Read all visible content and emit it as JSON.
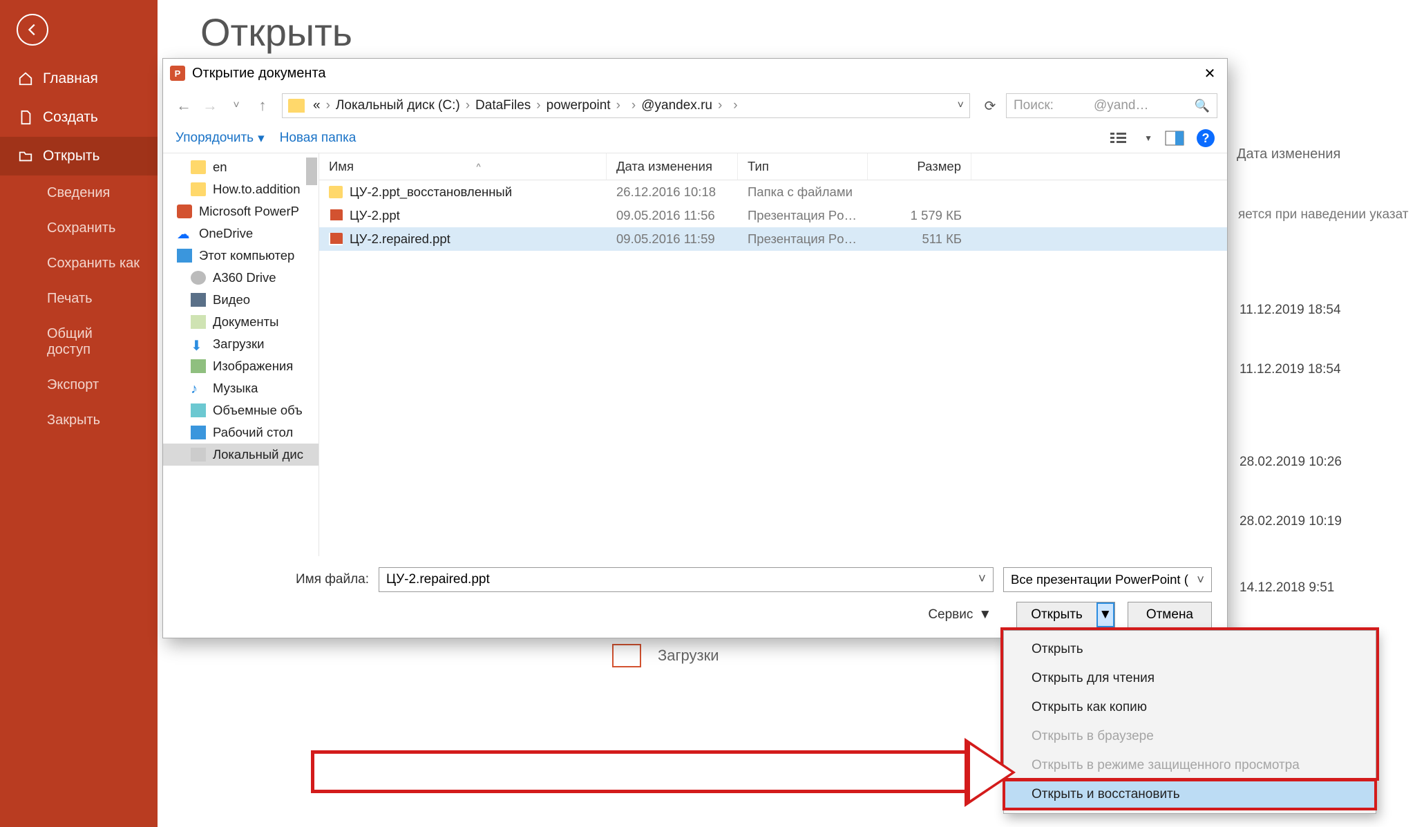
{
  "sidebar": {
    "items": [
      {
        "label": "Главная"
      },
      {
        "label": "Создать"
      },
      {
        "label": "Открыть"
      }
    ],
    "subs": [
      "Сведения",
      "Сохранить",
      "Сохранить как",
      "Печать",
      "Общий доступ",
      "Экспорт",
      "Закрыть"
    ]
  },
  "page_title": "Открыть",
  "dialog": {
    "title": "Открытие документа",
    "breadcrumbs": [
      "«",
      "Локальный диск (C:)",
      "DataFiles",
      "powerpoint",
      "",
      "@yandex.ru",
      ""
    ],
    "search_placeholder": "Поиск:",
    "search_right": "@yand…",
    "toolbar": {
      "organize": "Упорядочить",
      "newfolder": "Новая папка"
    },
    "tree": [
      {
        "label": "en",
        "icon": "folder",
        "sub": true
      },
      {
        "label": "How.to.addition",
        "icon": "folder",
        "sub": true
      },
      {
        "label": "Microsoft PowerP",
        "icon": "pp",
        "sub": false
      },
      {
        "label": "OneDrive",
        "icon": "cloud",
        "sub": false
      },
      {
        "label": "Этот компьютер",
        "icon": "pc",
        "sub": false
      },
      {
        "label": "A360 Drive",
        "icon": "disk",
        "sub": true
      },
      {
        "label": "Видео",
        "icon": "video",
        "sub": true
      },
      {
        "label": "Документы",
        "icon": "doc",
        "sub": true
      },
      {
        "label": "Загрузки",
        "icon": "dl",
        "sub": true
      },
      {
        "label": "Изображения",
        "icon": "img",
        "sub": true
      },
      {
        "label": "Музыка",
        "icon": "music",
        "sub": true
      },
      {
        "label": "Объемные объ",
        "icon": "3d",
        "sub": true
      },
      {
        "label": "Рабочий стол",
        "icon": "desk",
        "sub": true
      },
      {
        "label": "Локальный дис",
        "icon": "drive",
        "sub": true,
        "selected": true
      }
    ],
    "columns": {
      "name": "Имя",
      "date": "Дата изменения",
      "type": "Тип",
      "size": "Размер"
    },
    "rows": [
      {
        "name": "ЦУ-2.ppt_восстановленный",
        "date": "26.12.2016 10:18",
        "type": "Папка с файлами",
        "size": "",
        "icon": "folder"
      },
      {
        "name": "ЦУ-2.ppt",
        "date": "09.05.2016 11:56",
        "type": "Презентация Pow…",
        "size": "1 579 КБ",
        "icon": "ppt"
      },
      {
        "name": "ЦУ-2.repaired.ppt",
        "date": "09.05.2016 11:59",
        "type": "Презентация Pow…",
        "size": "511 КБ",
        "icon": "ppt",
        "selected": true
      }
    ],
    "filename_label": "Имя файла:",
    "filename_value": "ЦУ-2.repaired.ppt",
    "filetype": "Все презентации PowerPoint (",
    "service_label": "Сервис",
    "open_btn": "Открыть",
    "cancel_btn": "Отмена"
  },
  "open_menu": [
    {
      "label": "Открыть",
      "disabled": false
    },
    {
      "label": "Открыть для чтения",
      "disabled": false
    },
    {
      "label": "Открыть как копию",
      "disabled": false
    },
    {
      "label": "Открыть в браузере",
      "disabled": true
    },
    {
      "label": "Открыть в режиме защищенного просмотра",
      "disabled": true
    },
    {
      "label": "Открыть и восстановить",
      "disabled": false,
      "highlight": true
    }
  ],
  "bg": {
    "col_date": "Дата изменения",
    "hover_hint": "яется при наведении указат",
    "dates": [
      "11.12.2019 18:54",
      "11.12.2019 18:54",
      "28.02.2019 10:26",
      "28.02.2019 10:19",
      "14.12.2018 9:51"
    ],
    "downloads": "Загрузки"
  }
}
